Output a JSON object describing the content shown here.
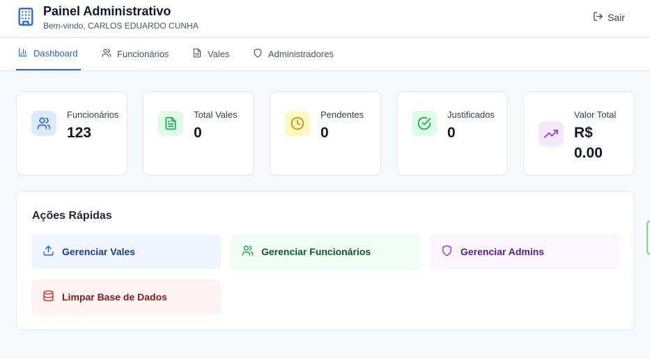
{
  "header": {
    "title": "Painel Administrativo",
    "subtitle": "Bem-vindo, CARLOS EDUARDO CUNHA",
    "logout_label": "Sair",
    "logo_icon": "building-icon"
  },
  "nav": {
    "tabs": [
      {
        "label": "Dashboard",
        "icon": "bar-chart-icon",
        "active": true
      },
      {
        "label": "Funcionários",
        "icon": "users-icon",
        "active": false
      },
      {
        "label": "Vales",
        "icon": "file-text-icon",
        "active": false
      },
      {
        "label": "Administradores",
        "icon": "shield-icon",
        "active": false
      }
    ]
  },
  "stats": [
    {
      "label": "Funcionários",
      "value": "123",
      "icon": "users-icon",
      "color": "#2563eb",
      "bg": "#dbeafe"
    },
    {
      "label": "Total Vales",
      "value": "0",
      "icon": "file-text-icon",
      "color": "#16a34a",
      "bg": "#dcfce7"
    },
    {
      "label": "Pendentes",
      "value": "0",
      "icon": "clock-icon",
      "color": "#ca8a04",
      "bg": "#fef9c3"
    },
    {
      "label": "Justificados",
      "value": "0",
      "icon": "check-circle-icon",
      "color": "#16a34a",
      "bg": "#dcfce7"
    },
    {
      "label": "Valor Total",
      "value": "R$ 0.00",
      "icon": "trending-up-icon",
      "color": "#9333ea",
      "bg": "#f3e8ff"
    }
  ],
  "quick_actions": {
    "title": "Ações Rápidas",
    "buttons": [
      {
        "label": "Gerenciar Vales",
        "icon": "upload-icon",
        "color": "#1e3a8a",
        "icon_color": "#2563eb",
        "bg": "#eff6ff"
      },
      {
        "label": "Gerenciar Funcionários",
        "icon": "users-icon",
        "color": "#14532d",
        "icon_color": "#16a34a",
        "bg": "#f0fdf4"
      },
      {
        "label": "Gerenciar Admins",
        "icon": "shield-icon",
        "color": "#581c87",
        "icon_color": "#9333ea",
        "bg": "#faf5ff"
      },
      {
        "label": "Limpar Base de Dados",
        "icon": "database-icon",
        "color": "#7f1d1d",
        "icon_color": "#dc2626",
        "bg": "#fef2f2"
      }
    ]
  },
  "colors": {
    "accent": "#2563eb",
    "background": "#f7f8fa",
    "border": "#e5e7eb"
  }
}
